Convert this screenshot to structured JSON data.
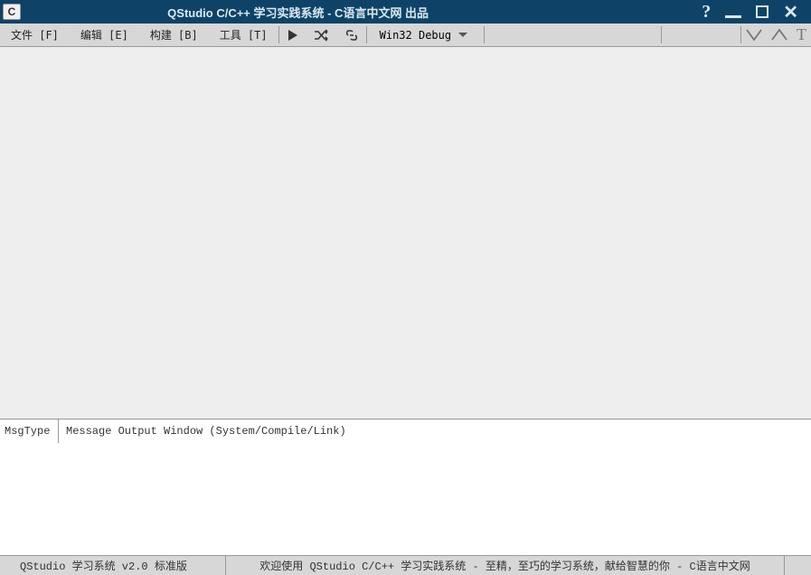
{
  "app_icon_letter": "C",
  "title": "QStudio C/C++ 学习实践系统 - C语言中文网 出品",
  "window_controls": {
    "help": "?",
    "close": "✕"
  },
  "menu": {
    "file": "文件 [F]",
    "edit": "编辑 [E]",
    "build": "构建 [B]",
    "tools": "工具 [T]"
  },
  "config": {
    "selected": "Win32 Debug"
  },
  "message_panel": {
    "col1": "MsgType",
    "col2": "Message Output Window (System/Compile/Link)"
  },
  "statusbar": {
    "version": "QStudio 学习系统 v2.0 标准版",
    "welcome": "欢迎使用 QStudio C/C++ 学习实践系统 - 至精，至巧的学习系统，献给智慧的你 - C语言中文网"
  }
}
